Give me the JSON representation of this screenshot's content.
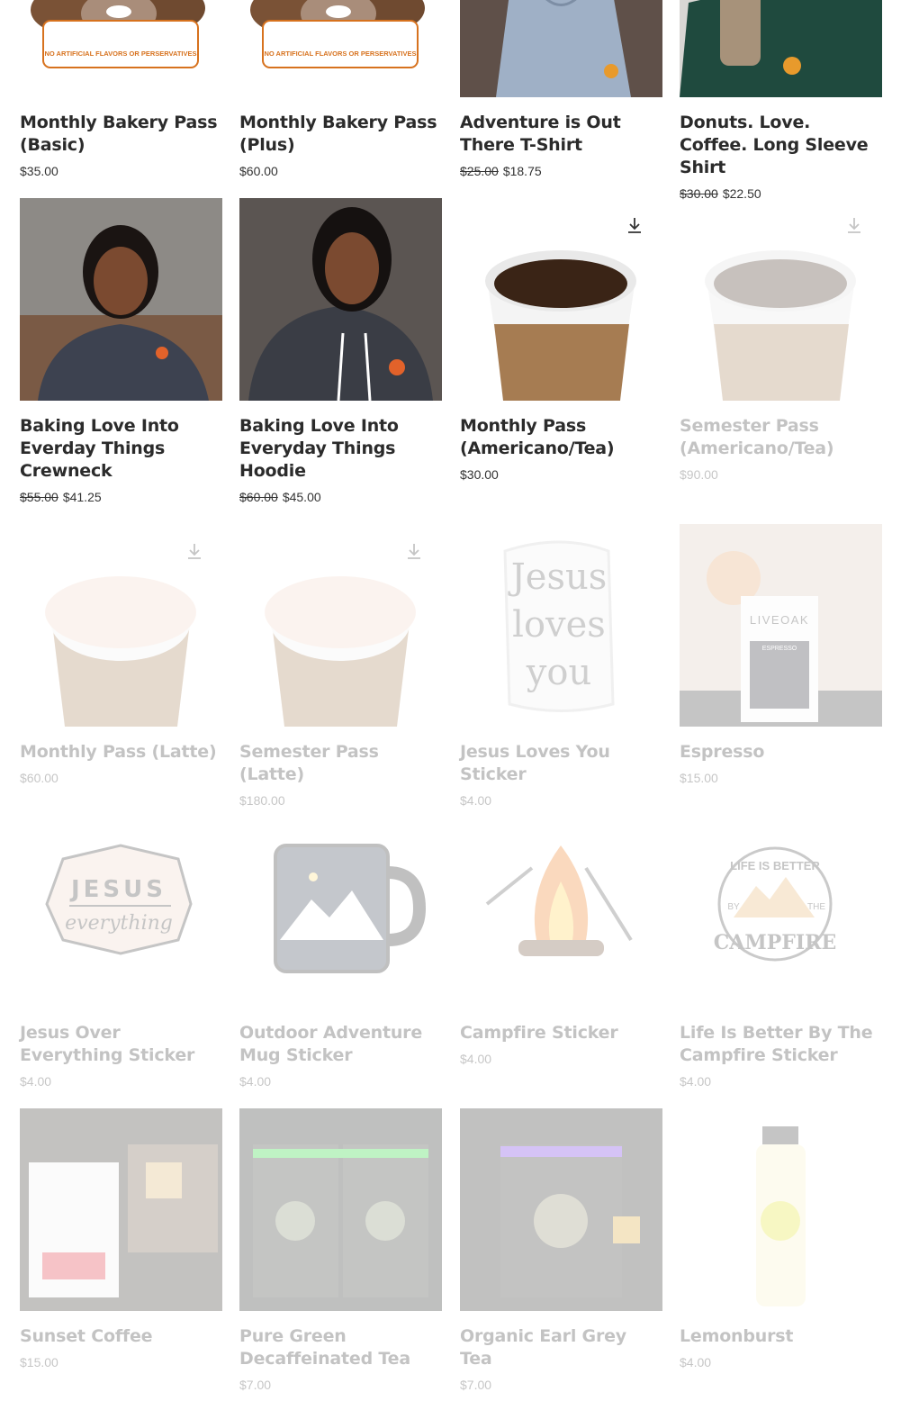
{
  "products": [
    {
      "title": "Monthly Bakery Pass (Basic)",
      "old_price": "",
      "price": "$35.00",
      "banner": "NO ARTIFICIAL FLAVORS OR PERSERVATIVES"
    },
    {
      "title": "Monthly Bakery Pass (Plus)",
      "old_price": "",
      "price": "$60.00",
      "banner": "NO ARTIFICIAL FLAVORS OR PERSERVATIVES"
    },
    {
      "title": "Adventure is Out There T-Shirt",
      "old_price": "$25.00",
      "price": "$18.75"
    },
    {
      "title": "Donuts. Love. Coffee. Long Sleeve Shirt",
      "old_price": "$30.00",
      "price": "$22.50"
    },
    {
      "title": "Baking Love Into Everday Things Crewneck",
      "old_price": "$55.00",
      "price": "$41.25"
    },
    {
      "title": "Baking Love Into Everyday Things Hoodie",
      "old_price": "$60.00",
      "price": "$45.00"
    },
    {
      "title": "Monthly Pass (Americano/Tea)",
      "old_price": "",
      "price": "$30.00"
    },
    {
      "title": "Semester Pass (Americano/Tea)",
      "old_price": "",
      "price": "$90.00"
    },
    {
      "title": "Monthly Pass (Latte)",
      "old_price": "",
      "price": "$60.00"
    },
    {
      "title": "Semester Pass (Latte)",
      "old_price": "",
      "price": "$180.00"
    },
    {
      "title": "Jesus Loves You Sticker",
      "old_price": "",
      "price": "$4.00",
      "art": [
        "Jesus",
        "loves",
        "you"
      ]
    },
    {
      "title": "Espresso",
      "old_price": "",
      "price": "$15.00",
      "brand": "LIVEOAK",
      "label": "ESPRESSO"
    },
    {
      "title": "Jesus Over Everything Sticker",
      "old_price": "",
      "price": "$4.00",
      "art": [
        "JESUS",
        "everything"
      ]
    },
    {
      "title": "Outdoor Adventure Mug Sticker",
      "old_price": "",
      "price": "$4.00"
    },
    {
      "title": "Campfire Sticker",
      "old_price": "",
      "price": "$4.00"
    },
    {
      "title": "Life Is Better By The Campfire Sticker",
      "old_price": "",
      "price": "$4.00",
      "art": [
        "LIFE IS BETTER",
        "BY",
        "THE",
        "CAMPFIRE"
      ]
    },
    {
      "title": "Sunset Coffee",
      "old_price": "",
      "price": "$15.00"
    },
    {
      "title": "Pure Green Decaffeinated Tea",
      "old_price": "",
      "price": "$7.00"
    },
    {
      "title": "Organic Earl Grey Tea",
      "old_price": "",
      "price": "$7.00"
    },
    {
      "title": "Lemonburst",
      "old_price": "",
      "price": "$4.00"
    }
  ],
  "colors": {
    "accent": "#e8731a",
    "text": "#2b2b2b",
    "sleeve": "#a67c52"
  }
}
